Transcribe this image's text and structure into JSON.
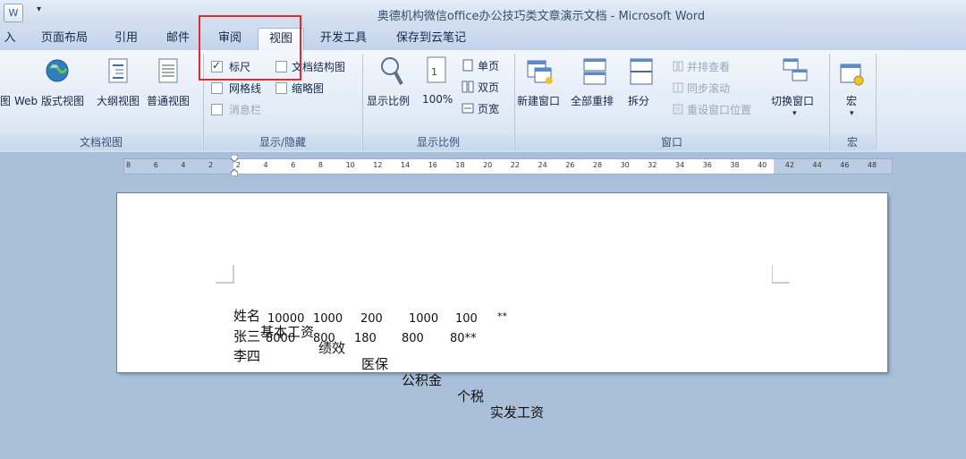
{
  "window": {
    "title": "奥德机构微信office办公技巧类文章演示文档 - Microsoft Word"
  },
  "tabs": [
    {
      "label": "入"
    },
    {
      "label": "页面布局"
    },
    {
      "label": "引用"
    },
    {
      "label": "邮件"
    },
    {
      "label": "审阅"
    },
    {
      "label": "视图",
      "active": true
    },
    {
      "label": "开发工具"
    },
    {
      "label": "保存到云笔记"
    }
  ],
  "ribbon": {
    "doc_views": {
      "label": "文档视图",
      "items": [
        {
          "label": "图"
        },
        {
          "label": "Web 版式视图"
        },
        {
          "label": "大纲视图"
        },
        {
          "label": "普通视图"
        }
      ]
    },
    "show_hide": {
      "label": "显示/隐藏",
      "ruler": {
        "label": "标尺",
        "checked": true
      },
      "doc_map": {
        "label": "文档结构图"
      },
      "gridlines": {
        "label": "网格线"
      },
      "thumbnails": {
        "label": "缩略图"
      },
      "message_bar": {
        "label": "消息栏"
      }
    },
    "zoom": {
      "label": "显示比例",
      "zoom_button": "显示比例",
      "percent_button": "100%",
      "one_page": "单页",
      "two_pages": "双页",
      "page_width": "页宽"
    },
    "window_group": {
      "label": "窗口",
      "new_window": "新建窗口",
      "arrange_all": "全部重排",
      "split": "拆分",
      "side_by_side": "并排查看",
      "sync_scroll": "同步滚动",
      "reset_position": "重设窗口位置",
      "switch_windows": "切换窗口"
    },
    "macros": {
      "label": "宏",
      "button": "宏"
    }
  },
  "ruler": {
    "ticks": [
      "8",
      "6",
      "4",
      "2",
      "2",
      "4",
      "6",
      "8",
      "10",
      "12",
      "14",
      "16",
      "18",
      "20",
      "22",
      "24",
      "26",
      "28",
      "30",
      "32",
      "34",
      "36",
      "38",
      "40",
      "42",
      "44",
      "46",
      "48"
    ]
  },
  "document": {
    "header": [
      "姓名",
      "基本工资",
      "绩效",
      "医保",
      "公积金",
      "个税",
      "实发工资"
    ],
    "rows": [
      [
        "张三",
        "10000",
        "1000",
        "200",
        "1000",
        "100",
        "**"
      ],
      [
        "李四",
        "8000",
        "800",
        "180",
        "800",
        "80**"
      ]
    ]
  },
  "colors": {
    "highlight": "#e8262c",
    "ribbon": "#e2ebf7",
    "workspace": "#aabfd9"
  }
}
